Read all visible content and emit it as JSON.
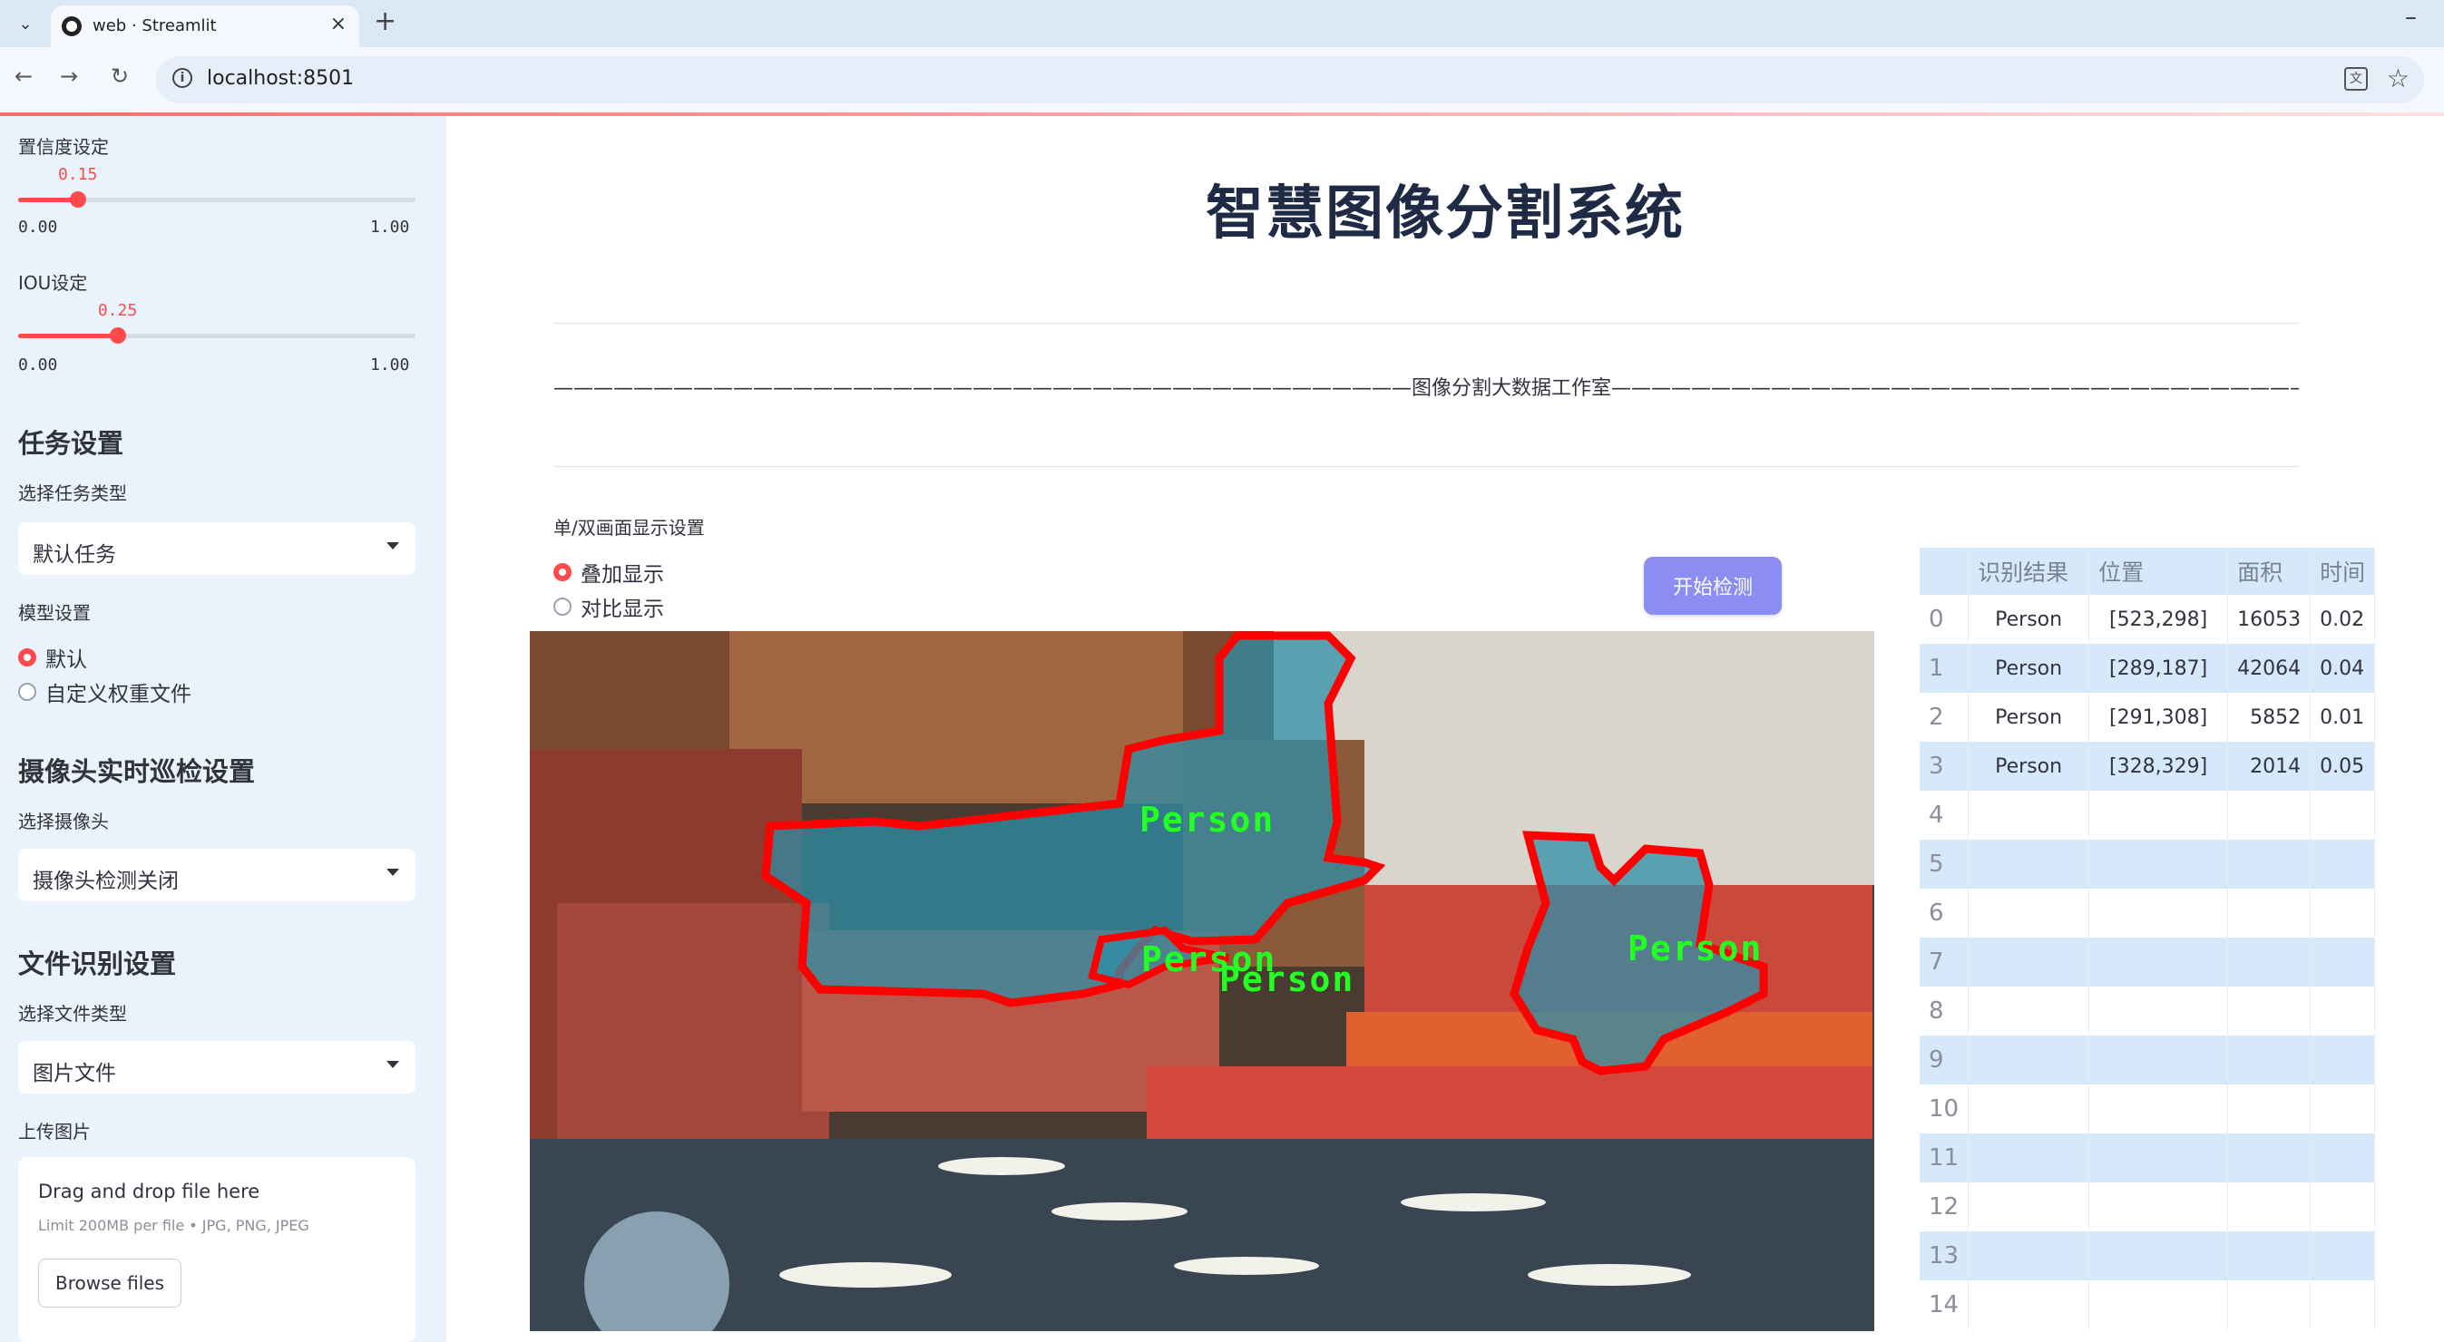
{
  "browser": {
    "tab_title": "web · Streamlit",
    "url": "localhost:8501"
  },
  "sidebar": {
    "confidence": {
      "label": "置信度设定",
      "value": "0.15",
      "min": "0.00",
      "max": "1.00",
      "fraction": 0.15
    },
    "iou": {
      "label": "IOU设定",
      "value": "0.25",
      "min": "0.00",
      "max": "1.00",
      "fraction": 0.25
    },
    "task_heading": "任务设置",
    "task_type_label": "选择任务类型",
    "task_type_value": "默认任务",
    "model_label": "模型设置",
    "model_options": [
      "默认",
      "自定义权重文件"
    ],
    "model_selected": 0,
    "camera_heading": "摄像头实时巡检设置",
    "camera_label": "选择摄像头",
    "camera_value": "摄像头检测关闭",
    "file_heading": "文件识别设置",
    "file_type_label": "选择文件类型",
    "file_type_value": "图片文件",
    "upload_label": "上传图片",
    "upload_title": "Drag and drop file here",
    "upload_limit": "Limit 200MB per file • JPG, PNG, JPEG",
    "browse_label": "Browse files"
  },
  "main": {
    "title": "智慧图像分割系统",
    "studio_line": "———————————————————————————————————————————图像分割大数据工作室———————————————————————————————————————————",
    "display_label": "单/双画面显示设置",
    "display_options": [
      "叠加显示",
      "对比显示"
    ],
    "display_selected": 0,
    "start_button": "开始检测",
    "detections": [
      "Person",
      "Person",
      "Person",
      "Person"
    ]
  },
  "table": {
    "headers": [
      "",
      "识别结果",
      "位置",
      "面积",
      "时间"
    ],
    "rows": [
      [
        "0",
        "Person",
        "[523,298]",
        "16053",
        "0.02"
      ],
      [
        "1",
        "Person",
        "[289,187]",
        "42064",
        "0.04"
      ],
      [
        "2",
        "Person",
        "[291,308]",
        "5852",
        "0.01"
      ],
      [
        "3",
        "Person",
        "[328,329]",
        "2014",
        "0.05"
      ],
      [
        "4",
        "",
        "",
        "",
        ""
      ],
      [
        "5",
        "",
        "",
        "",
        ""
      ],
      [
        "6",
        "",
        "",
        "",
        ""
      ],
      [
        "7",
        "",
        "",
        "",
        ""
      ],
      [
        "8",
        "",
        "",
        "",
        ""
      ],
      [
        "9",
        "",
        "",
        "",
        ""
      ],
      [
        "10",
        "",
        "",
        "",
        ""
      ],
      [
        "11",
        "",
        "",
        "",
        ""
      ],
      [
        "12",
        "",
        "",
        "",
        ""
      ],
      [
        "13",
        "",
        "",
        "",
        ""
      ],
      [
        "14",
        "",
        "",
        "",
        ""
      ]
    ]
  },
  "colors": {
    "accent": "#ff4b4b",
    "sidebar_bg": "#eaf3fb",
    "button": "#8b8df2",
    "mask_outline": "#ff0000",
    "mask_fill": "#2e8fa8",
    "label_text": "#22ff22"
  }
}
